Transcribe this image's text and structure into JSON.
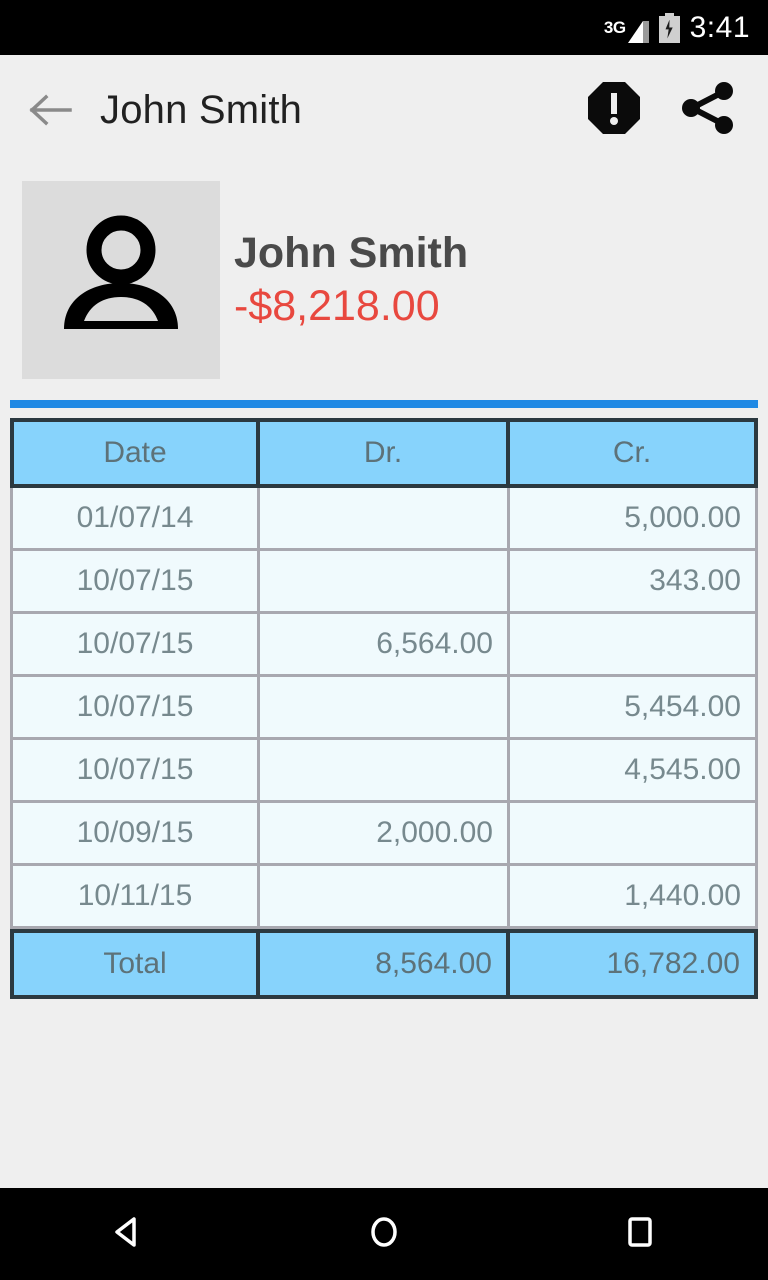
{
  "status_bar": {
    "network_label": "3G",
    "time": "3:41",
    "icons": [
      "signal-icon",
      "battery-charging-icon"
    ]
  },
  "app_bar": {
    "back_icon": "back-arrow-icon",
    "title": "John Smith",
    "actions": [
      {
        "name": "report-alert-icon",
        "label": "!"
      },
      {
        "name": "share-icon",
        "label": ""
      }
    ]
  },
  "profile": {
    "avatar_icon": "person-avatar-icon",
    "name": "John Smith",
    "balance": "-$8,218.00",
    "balance_color": "#E8483F"
  },
  "colors": {
    "accent_divider": "#2089E4",
    "table_header_bg": "#87D3FC",
    "table_row_bg": "#F0FAFD",
    "page_bg": "#EFEFEF"
  },
  "ledger": {
    "columns": [
      "Date",
      "Dr.",
      "Cr."
    ],
    "rows": [
      {
        "date": "01/07/14",
        "dr": "",
        "cr": "5,000.00"
      },
      {
        "date": "10/07/15",
        "dr": "",
        "cr": "343.00"
      },
      {
        "date": "10/07/15",
        "dr": "6,564.00",
        "cr": ""
      },
      {
        "date": "10/07/15",
        "dr": "",
        "cr": "5,454.00"
      },
      {
        "date": "10/07/15",
        "dr": "",
        "cr": "4,545.00"
      },
      {
        "date": "10/09/15",
        "dr": "2,000.00",
        "cr": ""
      },
      {
        "date": "10/11/15",
        "dr": "",
        "cr": "1,440.00"
      }
    ],
    "total": {
      "label": "Total",
      "dr": "8,564.00",
      "cr": "16,782.00"
    }
  },
  "nav_bar": {
    "buttons": [
      "back-nav-icon",
      "home-nav-icon",
      "recents-nav-icon"
    ]
  }
}
